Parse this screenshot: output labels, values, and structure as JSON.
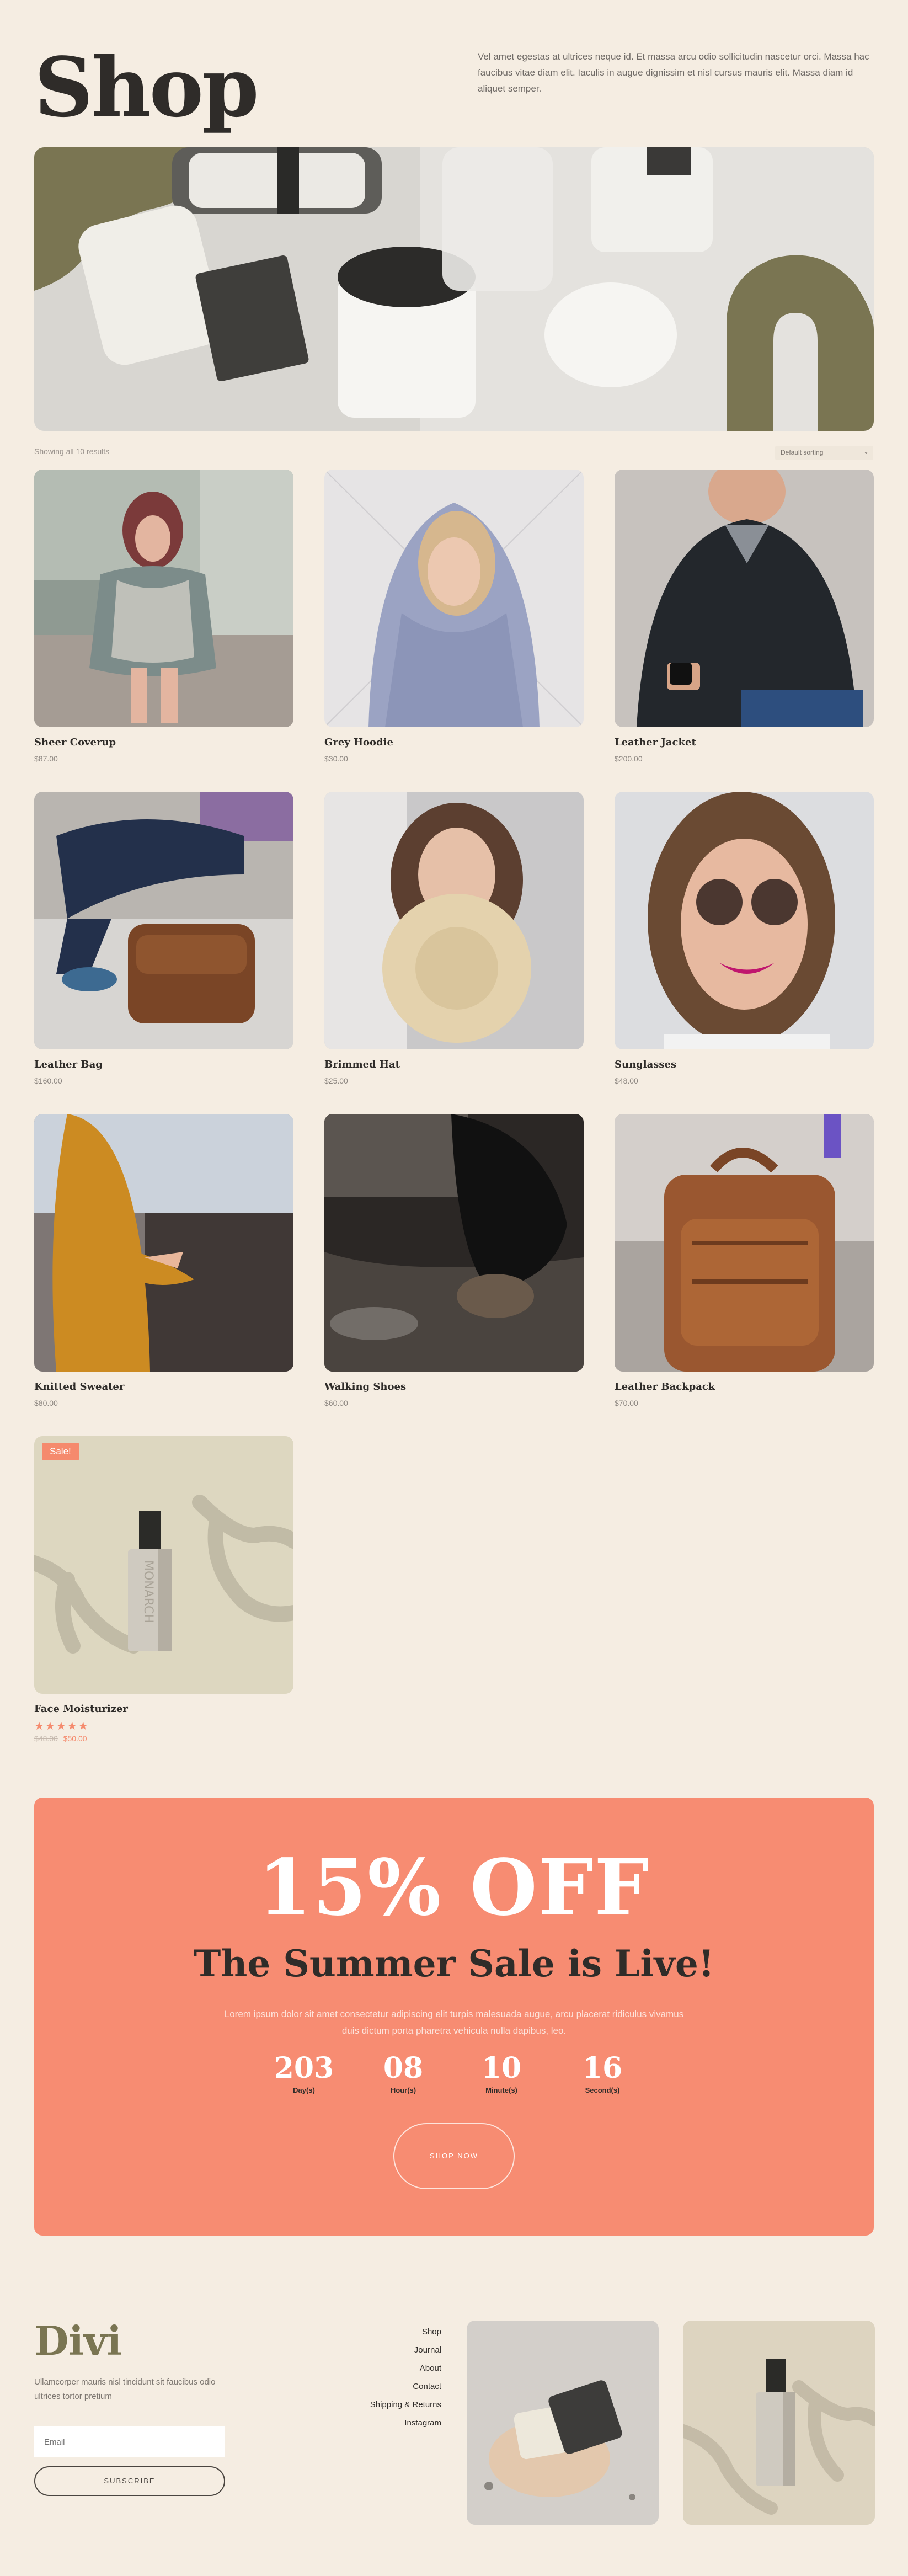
{
  "header": {
    "title": "Shop",
    "intro": "Vel amet egestas at ultrices neque id. Et massa arcu odio sollicitudin nascetur orci. Massa hac faucibus vitae diam elit. Iaculis in augue dignissim et nisl cursus mauris elit. Massa diam id aliquet semper."
  },
  "toolbar": {
    "results": "Showing all 10 results",
    "sort_selected": "Default sorting",
    "sort_icon": "chevron-down-icon"
  },
  "products": [
    {
      "name": "Sheer Coverup",
      "price": "$87.00"
    },
    {
      "name": "Grey Hoodie",
      "price": "$30.00"
    },
    {
      "name": "Leather Jacket",
      "price": "$200.00"
    },
    {
      "name": "Leather Bag",
      "price": "$160.00"
    },
    {
      "name": "Brimmed Hat",
      "price": "$25.00"
    },
    {
      "name": "Sunglasses",
      "price": "$48.00"
    },
    {
      "name": "Knitted Sweater",
      "price": "$80.00"
    },
    {
      "name": "Walking Shoes",
      "price": "$60.00"
    },
    {
      "name": "Leather Backpack",
      "price": "$70.00"
    }
  ],
  "featured": {
    "badge": "Sale!",
    "name": "Face Moisturizer",
    "stars": "★★★★★",
    "rating": 5,
    "old_price": "$48.00",
    "new_price": "$50.00"
  },
  "promo": {
    "discount": "15% OFF",
    "headline": "The Summer Sale is Live!",
    "body": "Lorem ipsum dolor sit amet consectetur adipiscing elit turpis malesuada augue, arcu placerat ridiculus vivamus duis dictum porta pharetra vehicula nulla dapibus, leo.",
    "countdown": [
      {
        "value": "203",
        "label": "Day(s)"
      },
      {
        "value": "08",
        "label": "Hour(s)"
      },
      {
        "value": "10",
        "label": "Minute(s)"
      },
      {
        "value": "16",
        "label": "Second(s)"
      }
    ],
    "button": "SHOP NOW"
  },
  "footer": {
    "logo": "Divi",
    "text": "Ullamcorper mauris nisl tincidunt sit faucibus odio ultrices tortor pretium",
    "email_placeholder": "Email",
    "subscribe": "SUBSCRIBE",
    "nav": [
      "Shop",
      "Journal",
      "About",
      "Contact",
      "Shipping & Returns",
      "Instagram"
    ]
  },
  "colors": {
    "background": "#f5ede2",
    "accent": "#f78c72",
    "olive": "#7a7552",
    "text": "#2f2c29"
  }
}
